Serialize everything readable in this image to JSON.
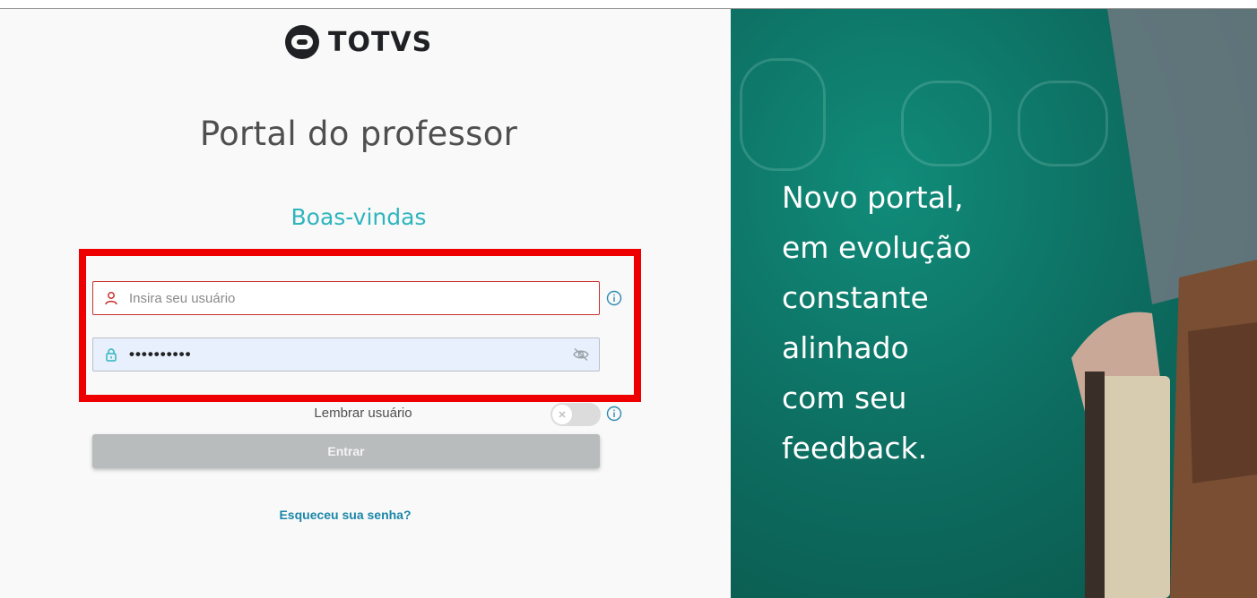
{
  "brand": {
    "logo_text": "TOTVS"
  },
  "page": {
    "title": "Portal do professor",
    "subtitle": "Boas-vindas"
  },
  "form": {
    "username": {
      "placeholder": "Insira seu usuário",
      "value": ""
    },
    "password": {
      "masked_value": "••••••••••"
    },
    "remember_label": "Lembrar usuário",
    "remember_enabled": false,
    "submit_label": "Entrar",
    "forgot_label": "Esqueceu sua senha?"
  },
  "hero": {
    "lines": [
      "Novo portal,",
      "em evolução",
      "constante",
      "alinhado",
      "com seu",
      "feedback."
    ]
  },
  "colors": {
    "accent": "#2fb5be",
    "link": "#1a86a8",
    "error_border": "#c9302c",
    "highlight_box": "#ee0000",
    "hero_background": "#0d6f62"
  }
}
